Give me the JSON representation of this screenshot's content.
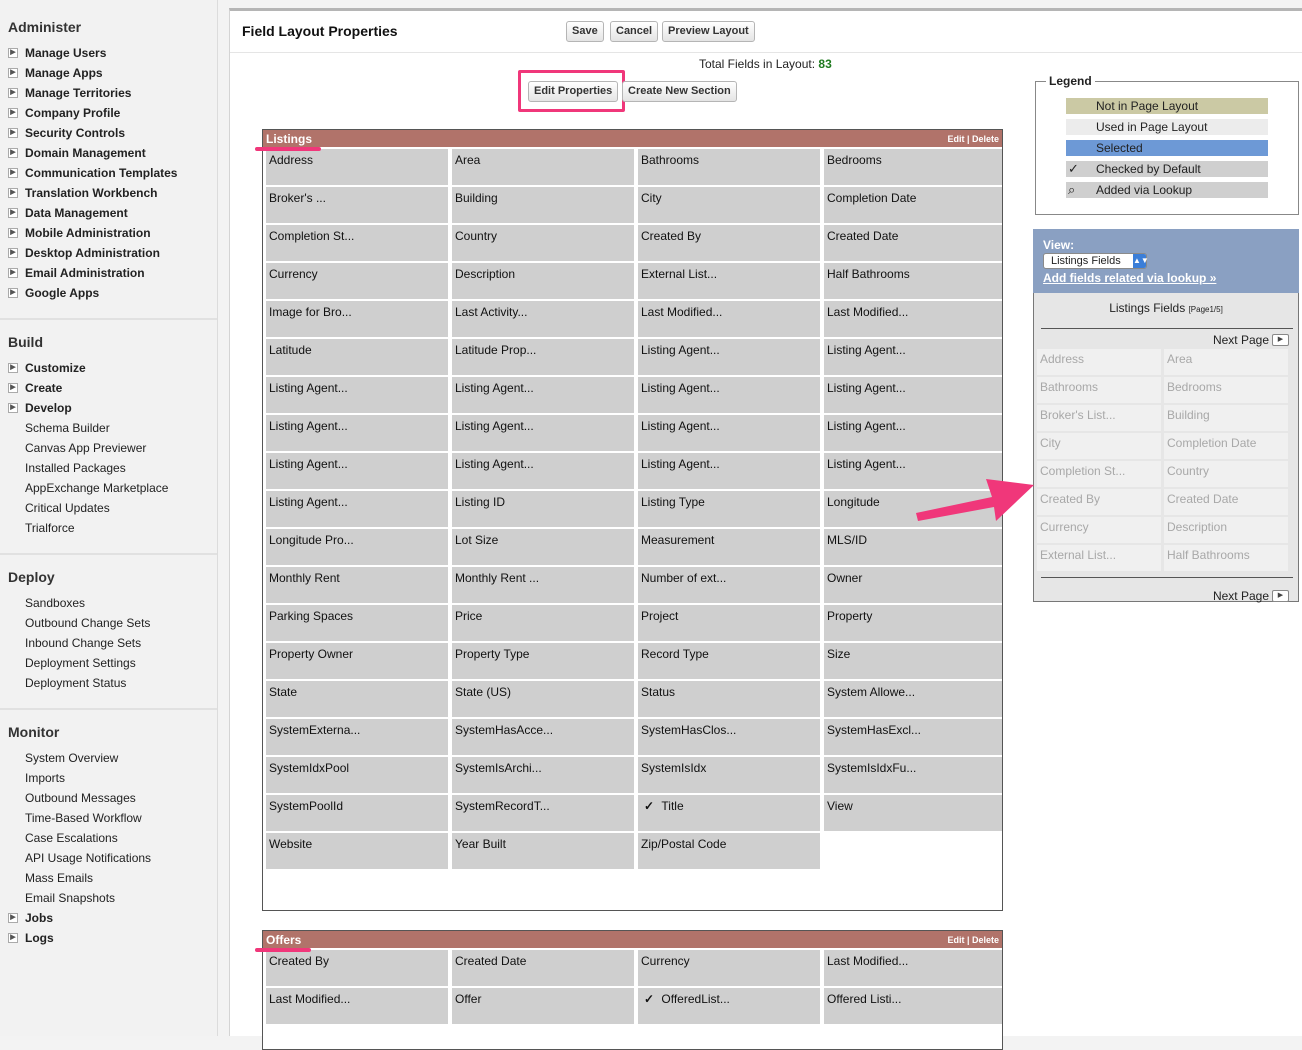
{
  "sidebar": {
    "administer": {
      "heading": "Administer",
      "items": [
        "Manage Users",
        "Manage Apps",
        "Manage Territories",
        "Company Profile",
        "Security Controls",
        "Domain Management",
        "Communication Templates",
        "Translation Workbench",
        "Data Management",
        "Mobile Administration",
        "Desktop Administration",
        "Email Administration",
        "Google Apps"
      ]
    },
    "build": {
      "heading": "Build",
      "items": [
        "Customize",
        "Create",
        "Develop"
      ],
      "sub_items": [
        "Schema Builder",
        "Canvas App Previewer",
        "Installed Packages",
        "AppExchange Marketplace",
        "Critical Updates",
        "Trialforce"
      ]
    },
    "deploy": {
      "heading": "Deploy",
      "sub_items": [
        "Sandboxes",
        "Outbound Change Sets",
        "Inbound Change Sets",
        "Deployment Settings",
        "Deployment Status"
      ]
    },
    "monitor": {
      "heading": "Monitor",
      "sub_items": [
        "System Overview",
        "Imports",
        "Outbound Messages",
        "Time-Based Workflow",
        "Case Escalations",
        "API Usage Notifications",
        "Mass Emails",
        "Email Snapshots"
      ],
      "items": [
        "Jobs",
        "Logs"
      ]
    },
    "toggle_icon": "expand-icon"
  },
  "header": {
    "title": "Field Layout Properties",
    "save_label": "Save",
    "cancel_label": "Cancel",
    "preview_label": "Preview Layout"
  },
  "total_fields": {
    "label": "Total Fields in Layout: ",
    "count": "83"
  },
  "actions": {
    "edit_properties": "Edit Properties",
    "create_section": "Create New Section"
  },
  "sections": [
    {
      "title": "Listings",
      "actions": "Edit | Delete",
      "fields": [
        "Address",
        "Area",
        "Bathrooms",
        "Bedrooms",
        "Broker's ...",
        "Building",
        "City",
        "Completion Date",
        "Completion St...",
        "Country",
        "Created By",
        "Created Date",
        "Currency",
        "Description",
        "External List...",
        "Half Bathrooms",
        "Image for Bro...",
        "Last Activity...",
        "Last Modified...",
        "Last Modified...",
        "Latitude",
        "Latitude Prop...",
        "Listing Agent...",
        "Listing Agent...",
        "Listing Agent...",
        "Listing Agent...",
        "Listing Agent...",
        "Listing Agent...",
        "Listing Agent...",
        "Listing Agent...",
        "Listing Agent...",
        "Listing Agent...",
        "Listing Agent...",
        "Listing Agent...",
        "Listing Agent...",
        "Listing Agent...",
        "Listing Agent...",
        "Listing ID",
        "Listing Type",
        "Longitude",
        "Longitude Pro...",
        "Lot Size",
        "Measurement",
        "MLS/ID",
        "Monthly Rent",
        "Monthly Rent ...",
        "Number of ext...",
        "Owner",
        "Parking Spaces",
        "Price",
        "Project",
        "Property",
        "Property Owner",
        "Property Type",
        "Record Type",
        "Size",
        "State",
        "State (US)",
        "Status",
        "System Allowe...",
        "SystemExterna...",
        "SystemHasAcce...",
        "SystemHasClos...",
        "SystemHasExcl...",
        "SystemIdxPool",
        "SystemIsArchi...",
        "SystemIsIdx",
        "SystemIsIdxFu...",
        "SystemPoolId",
        "SystemRecordT...",
        "Title",
        "View",
        "Website",
        "Year Built",
        "Zip/Postal Code"
      ],
      "checked_field": "Title"
    },
    {
      "title": "Offers",
      "actions": "Edit | Delete",
      "fields": [
        "Created By",
        "Created Date",
        "Currency",
        "Last Modified...",
        "Last Modified...",
        "Offer",
        "OfferedList...",
        "Offered Listi..."
      ],
      "checked_field": "OfferedList..."
    }
  ],
  "legend": {
    "title": "Legend",
    "items": [
      {
        "label": "Not in Page Layout",
        "color": "#cbc9a4"
      },
      {
        "label": "Used in Page Layout",
        "color": "#ececec"
      },
      {
        "label": "Selected",
        "color": "#6d99d6"
      },
      {
        "label": "Checked by Default",
        "color": "#cfcfcf",
        "icon": "checkmark-icon"
      },
      {
        "label": "Added via Lookup",
        "color": "#cfcfcf",
        "icon": "magnifier-icon"
      }
    ]
  },
  "view_panel": {
    "label": "View:",
    "selected": "Listings Fields",
    "lookup_link": "Add fields related via lookup »"
  },
  "palette": {
    "title": "Listings Fields",
    "page_info": "[Page1/5]",
    "next_page": "Next Page",
    "fields": [
      "Address",
      "Area",
      "Bathrooms",
      "Bedrooms",
      "Broker's List...",
      "Building",
      "City",
      "Completion Date",
      "Completion St...",
      "Country",
      "Created By",
      "Created Date",
      "Currency",
      "Description",
      "External List...",
      "Half Bathrooms"
    ]
  },
  "colors": {
    "section_header": "#b1736a",
    "annotation": "#f0377a",
    "view_panel": "#8aa0c2",
    "total_count": "#1f7a1f"
  }
}
